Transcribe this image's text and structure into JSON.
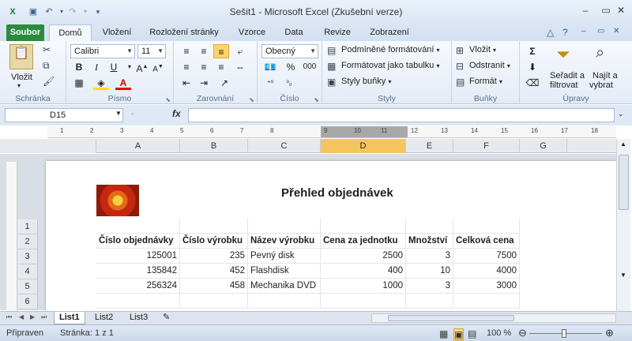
{
  "window": {
    "title": "Sešit1  -  Microsoft Excel (Zkušební verze)"
  },
  "tabs": [
    "Soubor",
    "Domů",
    "Vložení",
    "Rozložení stránky",
    "Vzorce",
    "Data",
    "Revize",
    "Zobrazení"
  ],
  "ribbon": {
    "clipboard": {
      "paste": "Vložit",
      "group": "Schránka"
    },
    "font": {
      "name": "Calibri",
      "size": "11",
      "group": "Písmo"
    },
    "alignment": {
      "group": "Zarovnání"
    },
    "number": {
      "format": "Obecný",
      "percent": "%",
      "thousands": "000",
      "group": "Číslo"
    },
    "styles": {
      "conditional": "Podmíněné formátování",
      "as_table": "Formátovat jako tabulku",
      "cell_styles": "Styly buňky",
      "group": "Styly"
    },
    "cells": {
      "insert": "Vložit",
      "delete": "Odstranit",
      "format": "Formát",
      "group": "Buňky"
    },
    "editing": {
      "sort_l1": "Seřadit a",
      "sort_l2": "filtrovat",
      "find_l1": "Najít a",
      "find_l2": "vybrat",
      "group": "Úpravy"
    }
  },
  "formula_bar": {
    "name_box": "D15",
    "fx": "fx",
    "value": ""
  },
  "columns": [
    "A",
    "B",
    "C",
    "D",
    "E",
    "F",
    "G"
  ],
  "selected_column": "D",
  "ruler": [
    "1",
    "2",
    "3",
    "4",
    "5",
    "6",
    "7",
    "8",
    "9",
    "10",
    "11",
    "12",
    "13",
    "14",
    "15",
    "16",
    "17",
    "18"
  ],
  "rows": [
    "1",
    "2",
    "3",
    "4",
    "5",
    "6"
  ],
  "sheet": {
    "title": "Přehled objednávek",
    "headers": [
      "Číslo objednávky",
      "Číslo výrobku",
      "Název výrobku",
      "Cena za jednotku",
      "Množství",
      "Celková cena"
    ],
    "data": [
      [
        "125001",
        "235",
        "Pevný disk",
        "2500",
        "3",
        "7500"
      ],
      [
        "135842",
        "452",
        "Flashdisk",
        "400",
        "10",
        "4000"
      ],
      [
        "256324",
        "458",
        "Mechanika DVD",
        "1000",
        "3",
        "3000"
      ]
    ]
  },
  "sheet_tabs": [
    "List1",
    "List2",
    "List3"
  ],
  "status": {
    "ready": "Připraven",
    "page": "Stránka: 1 z 1",
    "zoom": "100 %"
  }
}
